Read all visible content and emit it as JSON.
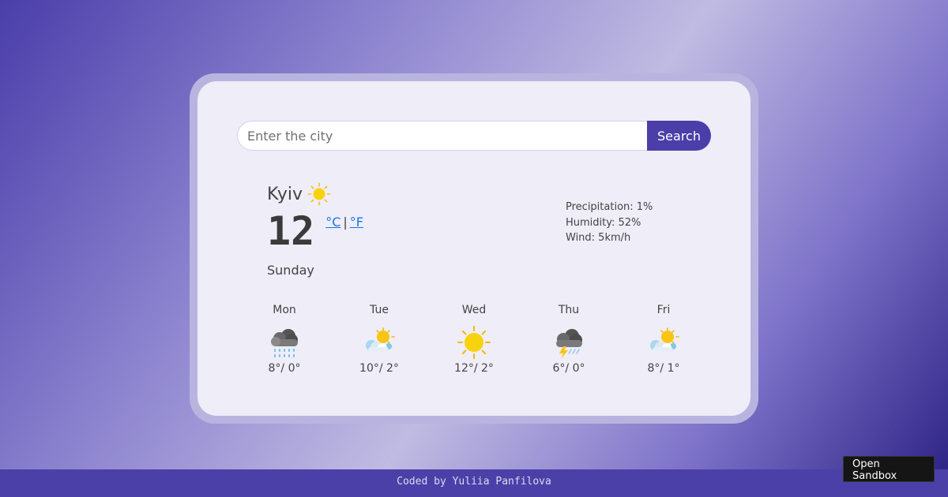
{
  "search": {
    "placeholder": "Enter the city",
    "value": "",
    "button_label": "Search"
  },
  "current": {
    "city": "Kyiv",
    "icon": "sunny-icon",
    "temperature": "12",
    "unit_celsius": "°C",
    "unit_separator": "|",
    "unit_fahrenheit": "°F",
    "day": "Sunday",
    "precipitation": "Precipitation: 1%",
    "humidity": "Humidity: 52%",
    "wind": "Wind: 5km/h"
  },
  "forecast": [
    {
      "day": "Mon",
      "icon": "heavy-rain-icon",
      "temps": "8°/ 0°"
    },
    {
      "day": "Tue",
      "icon": "partly-cloudy-icon",
      "temps": "10°/ 2°"
    },
    {
      "day": "Wed",
      "icon": "sunny-icon",
      "temps": "12°/ 2°"
    },
    {
      "day": "Thu",
      "icon": "thunderstorm-icon",
      "temps": "6°/ 0°"
    },
    {
      "day": "Fri",
      "icon": "partly-cloudy-icon",
      "temps": "8°/ 1°"
    }
  ],
  "footer": {
    "credit": "Coded by Yuliia Panfilova"
  },
  "sandbox": {
    "label": "Open Sandbox"
  },
  "colors": {
    "accent": "#4c3ea8",
    "card_background": "#eeedf8",
    "link": "#1a73e8",
    "sun": "#f9c513"
  }
}
